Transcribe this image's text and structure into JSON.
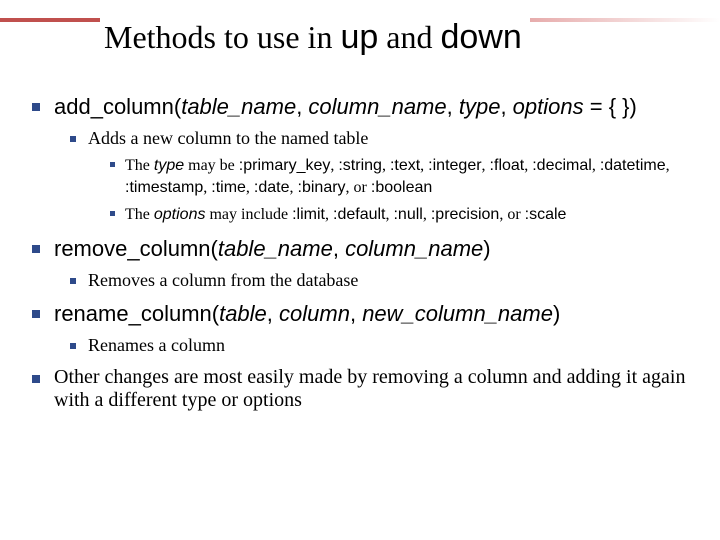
{
  "title": {
    "t1": "Methods to use in ",
    "t2": "up",
    "t3": " and ",
    "t4": "down"
  },
  "m1": {
    "name": "add_column",
    "lp": "(",
    "a1": "table_name",
    "a2": "column_name",
    "a3": "type",
    "a4": "options",
    "tail": " = { })",
    "sep": ", ",
    "desc": "Adds a new column to the named table",
    "detail1": {
      "p1": "The ",
      "p2": "type",
      "p3": " may be ",
      "p4": ":primary_key",
      "c": ", ",
      "p5": ":string",
      "p6": ":text",
      "p7": ":integer",
      "p8": ":float",
      "p9": ":decimal",
      "p10": ":datetime",
      "p11": ":timestamp",
      "p12": ":time",
      "p13": ":date",
      "p14": ":binary",
      "or": ", or ",
      "p15": ":boolean"
    },
    "detail2": {
      "p1": "The ",
      "p2": "options",
      "p3": " may include ",
      "p4": ":limit",
      "c": ", ",
      "p5": ":default",
      "p6": ":null",
      "p7": ":precision",
      "or": ", or ",
      "p8": ":scale"
    }
  },
  "m2": {
    "name": "remove_column",
    "lp": "(",
    "a1": "table_name",
    "a2": "column_name",
    "rp": ")",
    "sep": ", ",
    "desc": "Removes a column from the database"
  },
  "m3": {
    "name": "rename_column",
    "lp": "(",
    "a1": "table",
    "a2": "column",
    "a3": "new_column_name",
    "rp": ")",
    "sep": ", ",
    "desc": "Renames a column"
  },
  "other": "Other changes are most easily made by removing a column and adding it again with a different type or options"
}
